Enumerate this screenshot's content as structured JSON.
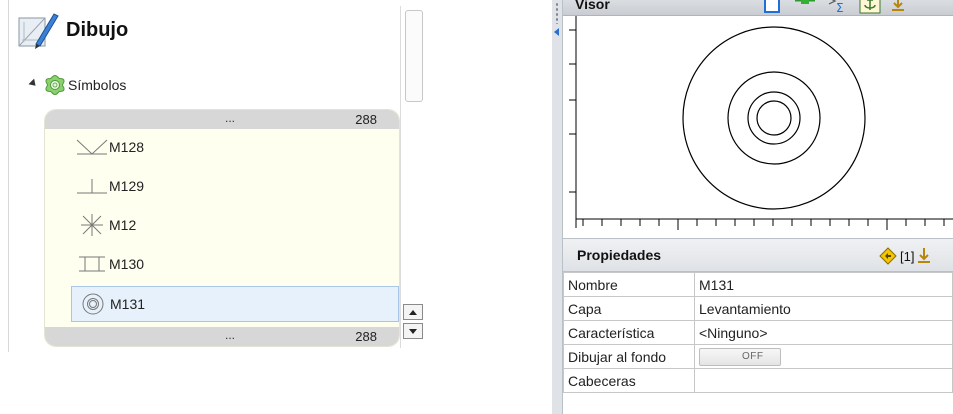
{
  "tree": {
    "document_title": "Dibujo",
    "document_icon": "drawing-tools-icon",
    "symbols_node_label": "Símbolos",
    "symbols_icon": "symbol-flower-icon",
    "list_top_bar": {
      "dots": "...",
      "count": "288"
    },
    "list_bottom_bar": {
      "dots": "...",
      "count": "288"
    },
    "items": [
      {
        "label": "M128",
        "icon": "symbol-v-shape-icon"
      },
      {
        "label": "M129",
        "icon": "symbol-tee-icon"
      },
      {
        "label": "M12",
        "icon": "symbol-asterisk-icon"
      },
      {
        "label": "M130",
        "icon": "symbol-i-beam-icon"
      },
      {
        "label": "M131",
        "icon": "symbol-concentric-circles-icon",
        "selected": true
      }
    ]
  },
  "visor": {
    "title": "Visor",
    "tools": [
      "export-icon",
      "flag-icon",
      "sum-icon",
      "anchor-icon",
      "download-icon"
    ]
  },
  "properties": {
    "title": "Propiedades",
    "badge_text": "[1]",
    "badge_icon": "diamond-warning-icon",
    "download_icon": "download-icon",
    "rows": [
      {
        "key": "Nombre",
        "value": "M131"
      },
      {
        "key": "Capa",
        "value": "Levantamiento"
      },
      {
        "key": "Característica",
        "value": "<Ninguno>"
      },
      {
        "key": "Dibujar al fondo",
        "toggle": "OFF"
      },
      {
        "key": "Cabeceras",
        "value": ""
      }
    ]
  },
  "colors": {
    "list_background": "#fffff0",
    "selection": "#e7f1fb",
    "accent_blue": "#2c6fd1",
    "symbol_green": "#5bb04a"
  }
}
